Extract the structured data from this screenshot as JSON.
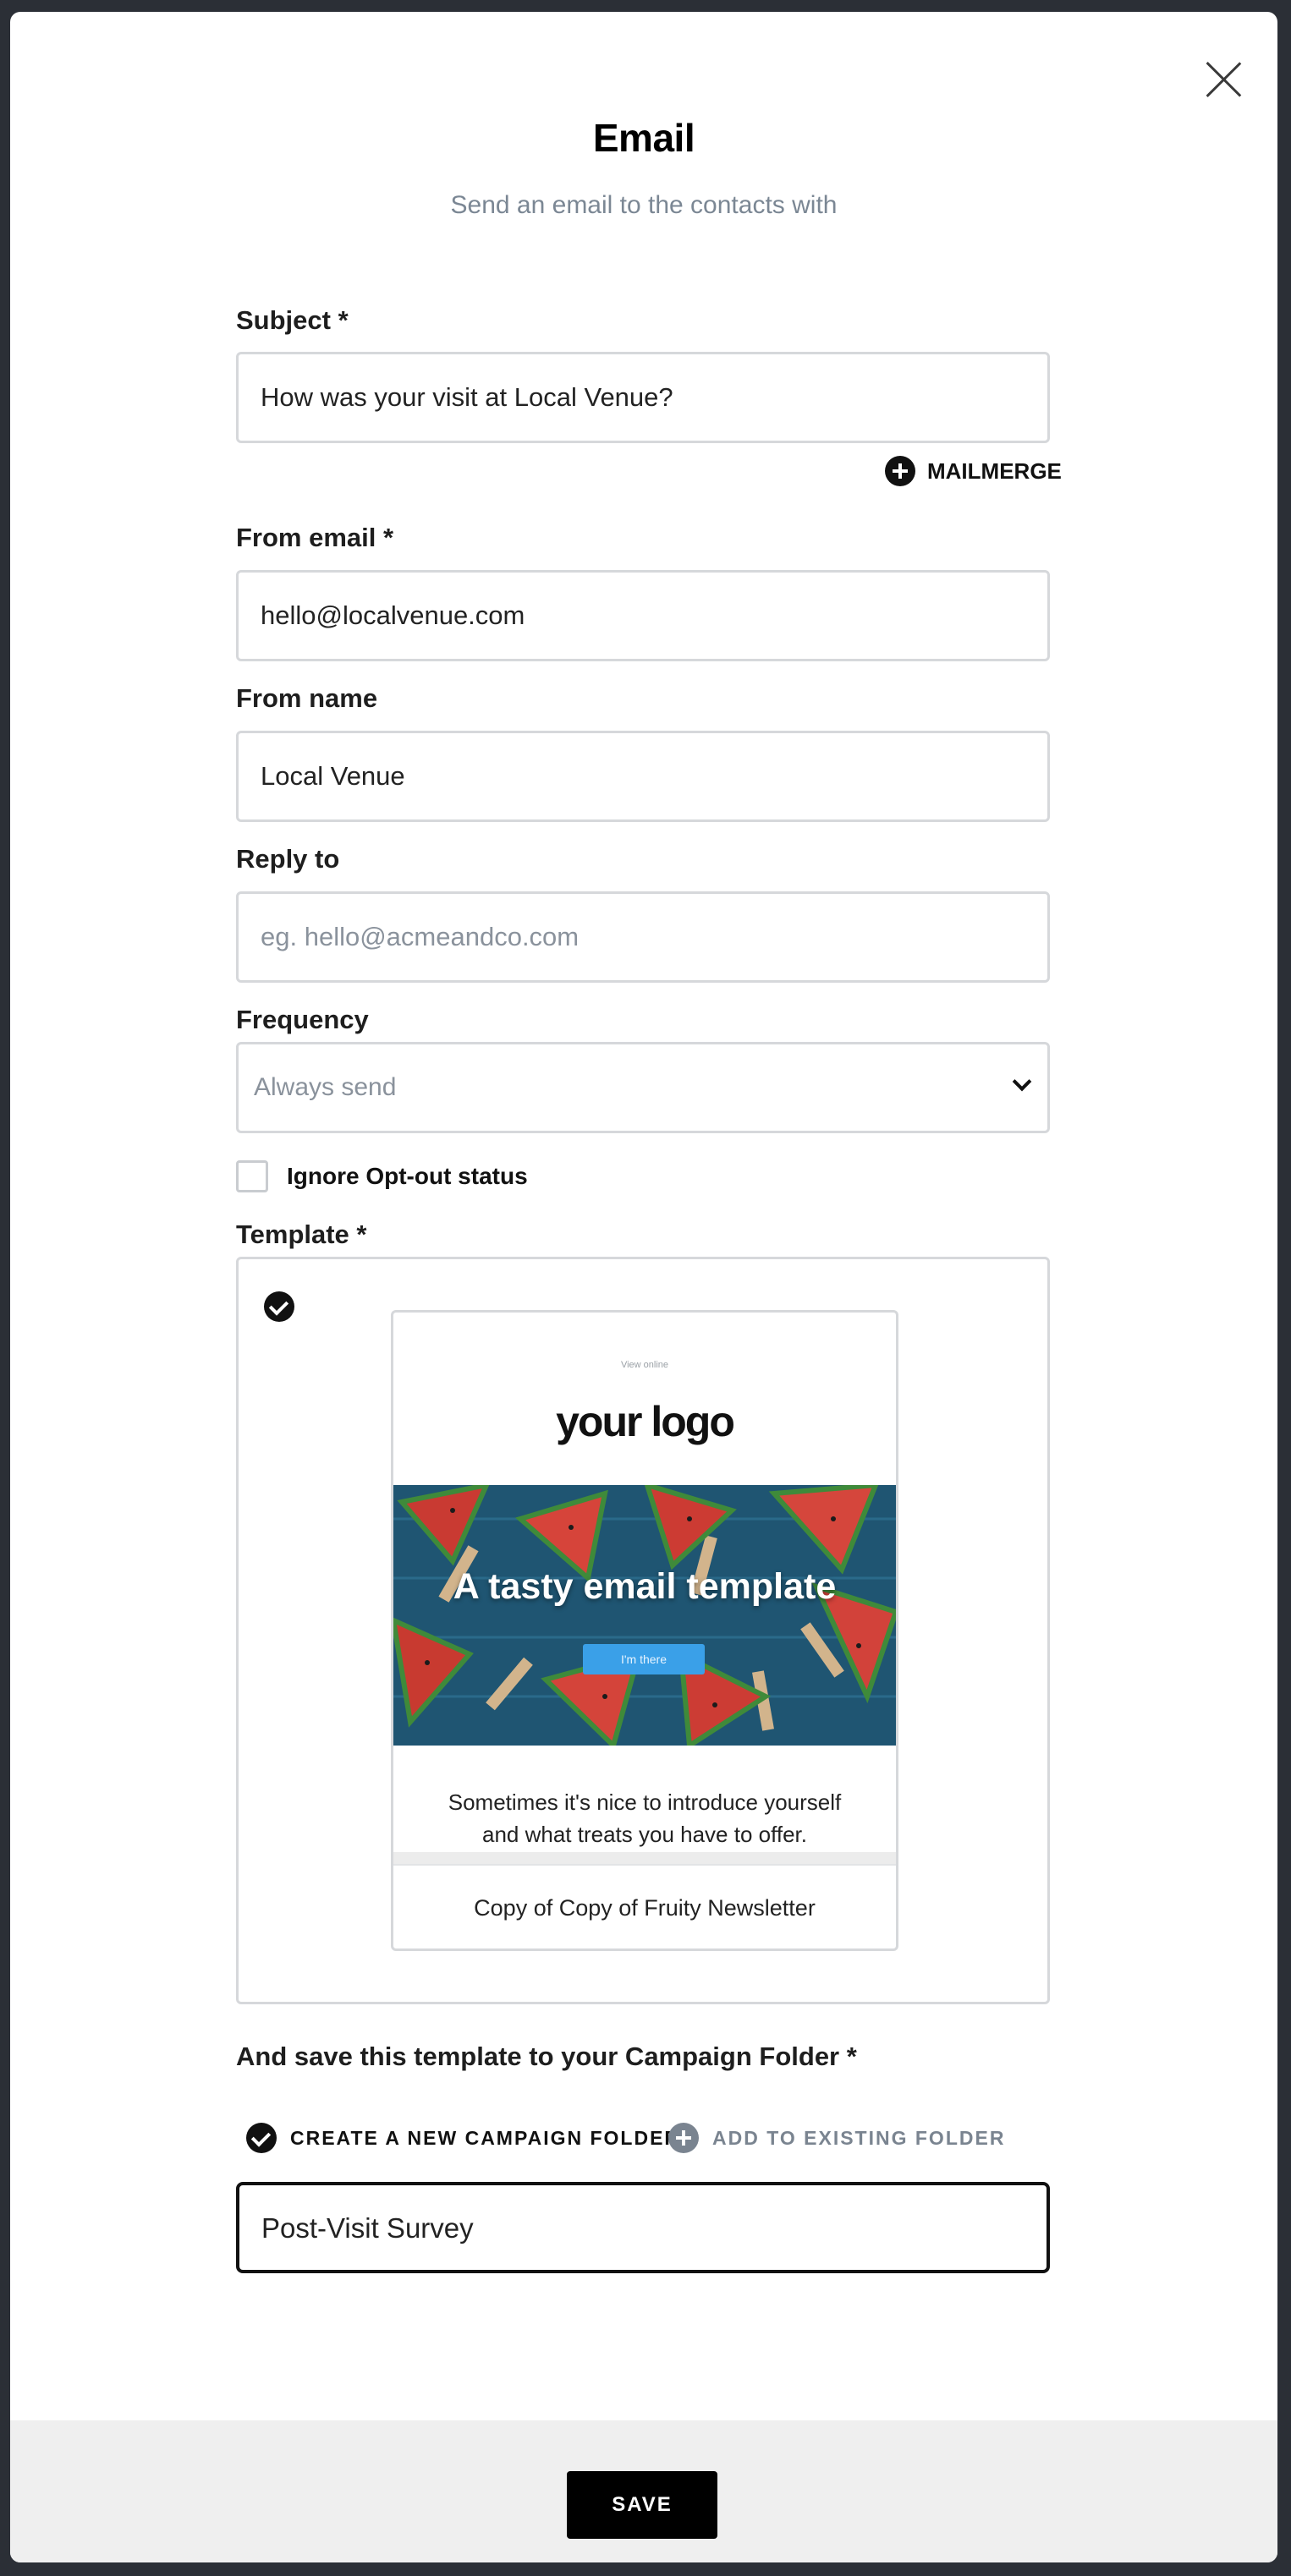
{
  "modal": {
    "title": "Email",
    "subtitle": "Send an email to the contacts with"
  },
  "form": {
    "subject": {
      "label": "Subject *",
      "value": "How was your visit at Local Venue?"
    },
    "mailmerge": {
      "label": "MAILMERGE",
      "icon": "plus-circle-icon"
    },
    "from_email": {
      "label": "From email *",
      "value": "hello@localvenue.com"
    },
    "from_name": {
      "label": "From name",
      "value": "Local Venue"
    },
    "reply_to": {
      "label": "Reply to",
      "placeholder": "eg. hello@acmeandco.com"
    },
    "frequency": {
      "label": "Frequency",
      "selected": "Always send"
    },
    "ignore_optout": {
      "label": "Ignore Opt-out status",
      "checked": false
    },
    "template": {
      "label": "Template *",
      "selected": true,
      "preview": {
        "view_online": "View online",
        "logo": "your logo",
        "hero_title": "A tasty email template",
        "hero_button": "I'm there",
        "body_line1": "Sometimes it's nice to introduce yourself",
        "body_line2": "and what treats you have to offer."
      },
      "name": "Copy of Copy of Fruity Newsletter"
    },
    "campaign_folder": {
      "label": "And save this template to your Campaign Folder *",
      "options": [
        {
          "label": "CREATE A NEW CAMPAIGN FOLDER",
          "selected": true,
          "icon": "check-circle-icon"
        },
        {
          "label": "ADD TO EXISTING FOLDER",
          "selected": false,
          "icon": "plus-circle-icon"
        }
      ],
      "folder_name": "Post-Visit Survey"
    }
  },
  "footer": {
    "save_label": "SAVE"
  },
  "colors": {
    "accent": "#000000",
    "muted_text": "#7b8794",
    "border": "#d6d8db",
    "footer_bg": "#efefef",
    "hero_button": "#3aa0e8"
  }
}
